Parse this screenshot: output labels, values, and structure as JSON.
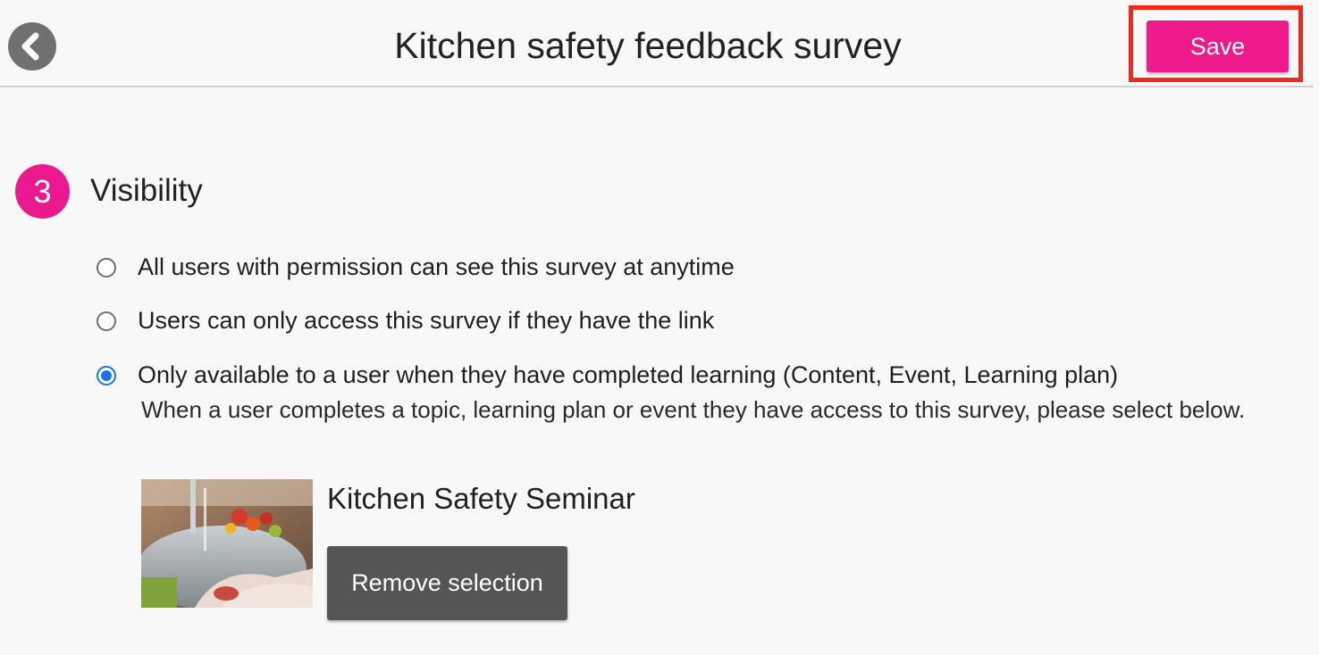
{
  "header": {
    "title": "Kitchen safety feedback survey",
    "back_icon": "chevron-left-icon",
    "save_label": "Save",
    "save_color": "#ee1a8c",
    "highlight_color": "#f0281e"
  },
  "section": {
    "step_number": "3",
    "step_color": "#ea1a8e",
    "title": "Visibility"
  },
  "visibility_options": [
    {
      "label": "All users with permission can see this survey at anytime",
      "selected": false
    },
    {
      "label": "Users can only access this survey if they have the link",
      "selected": false
    },
    {
      "label": "Only available to a user when they have completed learning (Content, Event, Learning plan)",
      "selected": true
    }
  ],
  "selected_option_description": "When a user completes a topic, learning plan or event they have access to this survey, please select below.",
  "selected_item": {
    "title": "Kitchen Safety Seminar",
    "remove_label": "Remove selection"
  },
  "colors": {
    "radio_selected": "#1a73e8",
    "remove_button": "#555555"
  }
}
